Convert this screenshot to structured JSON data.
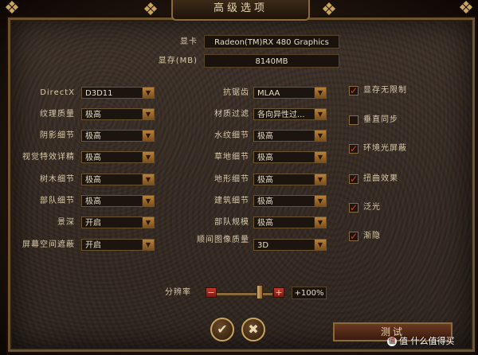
{
  "window": {
    "title": "高级选项"
  },
  "gpu": {
    "label": "显卡",
    "value": "Radeon(TM)RX 480 Graphics"
  },
  "vram": {
    "label": "显存(MB)",
    "value": "8140MB"
  },
  "left_settings": [
    {
      "label": "DirectX",
      "value": "D3D11"
    },
    {
      "label": "纹理质量",
      "value": "极高"
    },
    {
      "label": "阴影细节",
      "value": "极高"
    },
    {
      "label": "视觉特效详精",
      "value": "极高"
    },
    {
      "label": "树木细节",
      "value": "极高"
    },
    {
      "label": "部队细节",
      "value": "极高"
    },
    {
      "label": "景深",
      "value": "开启"
    },
    {
      "label": "屏幕空间遮蔽",
      "value": "开启"
    }
  ],
  "mid_settings": [
    {
      "label": "抗锯齿",
      "value": "MLAA"
    },
    {
      "label": "材质过滤",
      "value": "各向异性过..."
    },
    {
      "label": "水纹细节",
      "value": "极高"
    },
    {
      "label": "草地细节",
      "value": "极高"
    },
    {
      "label": "地形细节",
      "value": "极高"
    },
    {
      "label": "建筑细节",
      "value": "极高"
    },
    {
      "label": "部队规模",
      "value": "极高"
    },
    {
      "label": "顺间图像质量",
      "value": "3D"
    }
  ],
  "checkboxes": [
    {
      "label": "显存无限制",
      "checked": true
    },
    {
      "label": "垂直同步",
      "checked": false
    },
    {
      "label": "环境光屏蔽",
      "checked": true
    },
    {
      "label": "扭曲效果",
      "checked": true
    },
    {
      "label": "泛光",
      "checked": true
    },
    {
      "label": "渐隐",
      "checked": true
    }
  ],
  "resolution": {
    "label": "分辨率",
    "value": "+100%",
    "level": 0.8
  },
  "buttons": {
    "confirm_icon": "check-icon",
    "cancel_icon": "x-icon",
    "test_label": "测试"
  },
  "watermark": {
    "text": "值 什么值得买"
  },
  "glyphs": {
    "check": "✓",
    "cross": "✕",
    "arrow": "▼",
    "minus": "−",
    "plus": "+",
    "orn": "❖",
    "confirm": "✔",
    "cancel": "✖"
  }
}
